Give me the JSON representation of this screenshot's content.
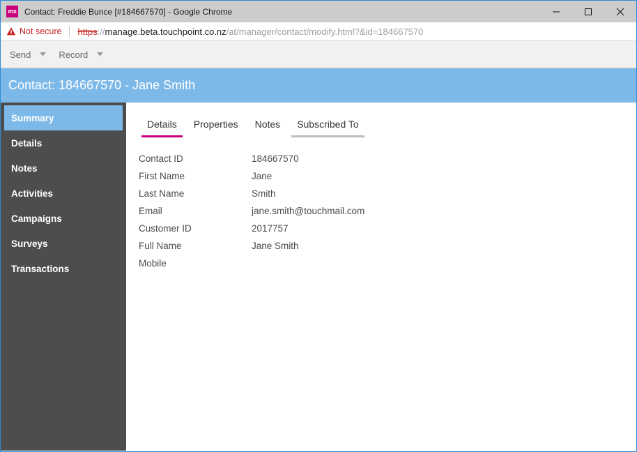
{
  "window": {
    "title": "Contact: Freddie Bunce [#184667570] - Google Chrome",
    "favicon_text": "mx",
    "favicon_color": "#C8007C",
    "controls": {
      "minimize": "minimize-icon",
      "maximize": "maximize-icon",
      "close": "close-icon"
    }
  },
  "urlbar": {
    "security_icon": "warning-triangle-icon",
    "security_label": "Not secure",
    "url_scheme": "https",
    "url_separator": "://",
    "url_host": "manage.beta.touchpoint.co.nz",
    "url_path": "/at/manager/contact/modify.html?&id=184667570",
    "security_color": "#C5221F"
  },
  "toolbar": {
    "items": [
      {
        "label": "Send",
        "caret": "chevron-down-icon"
      },
      {
        "label": "Record",
        "caret": "chevron-down-icon"
      }
    ]
  },
  "page_header": {
    "title": "Contact: 184667570 - Jane Smith",
    "background": "#7DB9E8"
  },
  "sidebar": {
    "items": [
      {
        "label": "Summary",
        "active": true
      },
      {
        "label": "Details",
        "active": false
      },
      {
        "label": "Notes",
        "active": false
      },
      {
        "label": "Activities",
        "active": false
      },
      {
        "label": "Campaigns",
        "active": false
      },
      {
        "label": "Surveys",
        "active": false
      },
      {
        "label": "Transactions",
        "active": false
      }
    ],
    "background": "#4D4D4D",
    "active_background": "#7DB9E8"
  },
  "content": {
    "tabs": [
      {
        "label": "Details",
        "state": "active"
      },
      {
        "label": "Properties",
        "state": "normal"
      },
      {
        "label": "Notes",
        "state": "normal"
      },
      {
        "label": "Subscribed To",
        "state": "hovered"
      }
    ],
    "active_tab_color": "#C8007C",
    "hover_tab_color": "#BDBDBD",
    "fields": [
      {
        "label": "Contact ID",
        "value": "184667570"
      },
      {
        "label": "First Name",
        "value": "Jane"
      },
      {
        "label": "Last Name",
        "value": "Smith"
      },
      {
        "label": "Email",
        "value": "jane.smith@touchmail.com"
      },
      {
        "label": "Customer ID",
        "value": "2017757"
      },
      {
        "label": "Full Name",
        "value": "Jane Smith"
      },
      {
        "label": "Mobile",
        "value": ""
      }
    ]
  }
}
